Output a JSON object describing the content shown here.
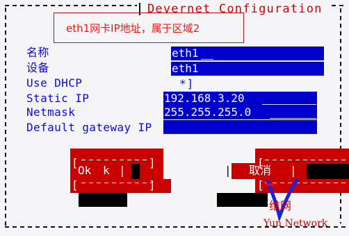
{
  "window": {
    "title": "Devernet Configuration"
  },
  "annotation": {
    "text": "eth1网卡IP地址，属于区域2"
  },
  "form": {
    "name_label": "名称",
    "name_value": "eth1",
    "device_label": "设备",
    "device_value": "eth1",
    "use_dhcp_label": "Use DHCP",
    "use_dhcp_value": "*]",
    "static_ip_label": "Static IP",
    "static_ip_value": "192.168.3.20",
    "netmask_label": "Netmask",
    "netmask_value": "255.255.255.0",
    "gateway_label": "Default gateway IP",
    "gateway_value": ""
  },
  "buttons": {
    "ok_label": "Ok",
    "ok_suffix": "k",
    "cancel_label": "取消"
  },
  "watermark": {
    "cn_text": "维网",
    "en_text": "Yun  Network"
  },
  "colors": {
    "accent_blue": "#0000cc",
    "label_blue": "#0a0ad8",
    "button_red": "#c80000",
    "annotation_red": "#ff1111",
    "background": "#f5f5f7"
  },
  "icons": {
    "watermark": "v-logo-icon"
  }
}
